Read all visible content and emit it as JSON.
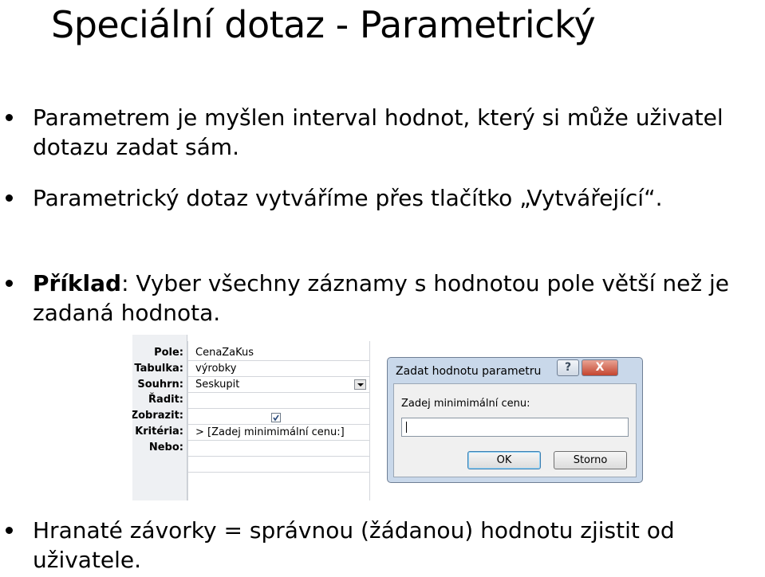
{
  "title": "Speciální dotaz - Parametrický",
  "bullets": [
    {
      "text": "Parametrem je myšlen interval hodnot, který si může uživatel dotazu zadat sám."
    },
    {
      "text": "Parametrický dotaz vytváříme přes tlačítko „Vytvářející“."
    },
    {
      "bold": "Příklad",
      "text": ": Vyber všechny záznamy s hodnotou pole větší než je zadaná hodnota."
    },
    {
      "text": "Hranaté závorky = správnou (žádanou) hodnotu zjistit od uživatele."
    }
  ],
  "query_grid": {
    "row_labels": [
      "Pole:",
      "Tabulka:",
      "Souhrn:",
      "Řadit:",
      "Zobrazit:",
      "Kritéria:",
      "Nebo:"
    ],
    "values": {
      "pole": "CenaZaKus",
      "tabulka": "výrobky",
      "souhrn": "Seskupit",
      "zobrazit_checked": true,
      "kriteria": "> [Zadej minimimální cenu:]"
    }
  },
  "dialog": {
    "title": "Zadat hodnotu parametru",
    "help_label": "?",
    "close_label": "X",
    "prompt": "Zadej minimimální cenu:",
    "input_value": "",
    "ok_label": "OK",
    "cancel_label": "Storno"
  }
}
